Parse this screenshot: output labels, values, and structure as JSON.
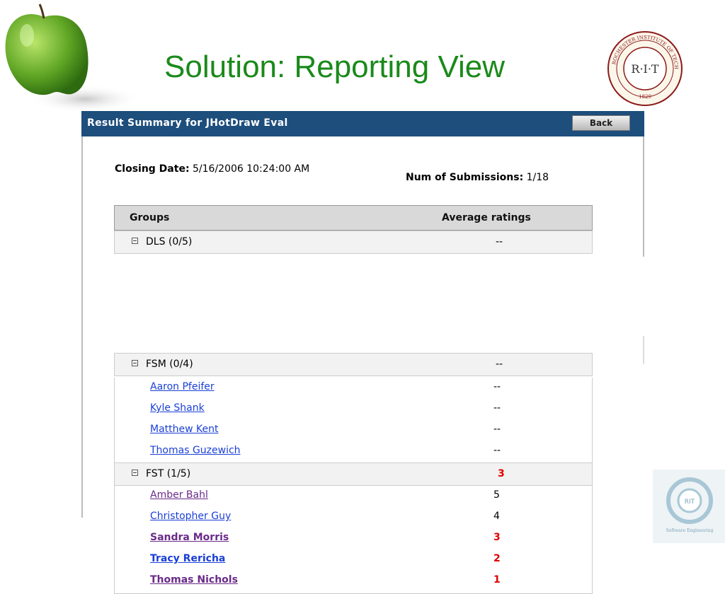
{
  "slide": {
    "title": "Solution: Reporting View"
  },
  "panel": {
    "title": "Result Summary for JHotDraw Eval",
    "back_label": "Back",
    "closing_label": "Closing Date:",
    "closing_value": "5/16/2006 10:24:00 AM",
    "subs_label": "Num of Submissions:",
    "subs_value": "1/18"
  },
  "table": {
    "headers": [
      "Groups",
      "Average ratings"
    ],
    "groups": [
      {
        "name": "DLS (0/5)",
        "avg": "--",
        "members": []
      },
      {
        "name": "FSM (0/4)",
        "avg": "--",
        "members": [
          {
            "name": "Aaron Pfeifer",
            "rating": "--"
          },
          {
            "name": "Kyle Shank",
            "rating": "--"
          },
          {
            "name": "Matthew Kent",
            "rating": "--"
          },
          {
            "name": "Thomas Guzewich",
            "rating": "--"
          }
        ]
      },
      {
        "name": "FST (1/5)",
        "avg": "3",
        "members": [
          {
            "name": "Amber Bahl",
            "rating": "5"
          },
          {
            "name": "Christopher Guy",
            "rating": "4"
          },
          {
            "name": "Sandra Morris",
            "rating": "3"
          },
          {
            "name": "Tracy Rericha",
            "rating": "2"
          },
          {
            "name": "Thomas Nichols",
            "rating": "1"
          }
        ]
      }
    ]
  },
  "logos": {
    "rit_seal_text": "R·I·T",
    "rit_seal_ring": "ROCHESTER INSTITUTE OF TECHNOLOGY",
    "rit_seal_year": "1829",
    "se_logo_text": "Software Engineering"
  },
  "colors": {
    "title_green": "#1a8a1a",
    "header_blue": "#1d4e7c",
    "link_blue": "#1a3fd6",
    "link_visited": "#6a2a8a",
    "rating_red": "#e00000"
  }
}
